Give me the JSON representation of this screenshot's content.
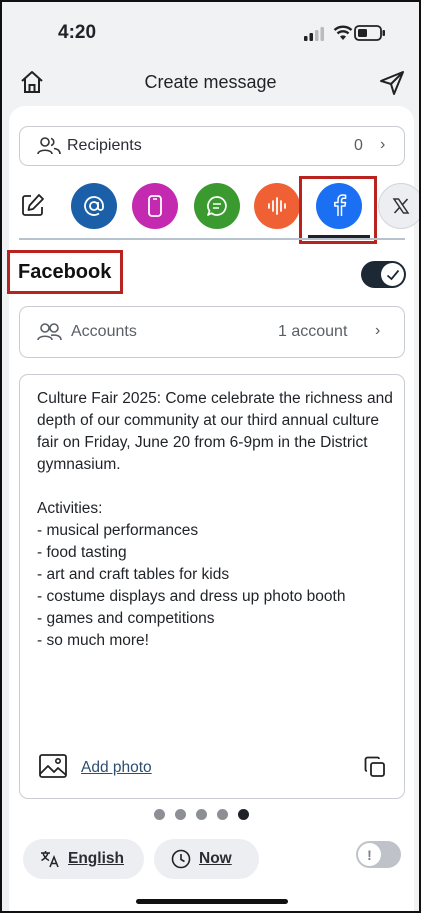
{
  "status_bar": {
    "time": "4:20"
  },
  "header": {
    "title": "Create message",
    "home_icon": "home-icon",
    "send_icon": "paper-plane-icon"
  },
  "recipients": {
    "label": "Recipients",
    "count": "0",
    "icon": "people-icon"
  },
  "channels": [
    {
      "name": "compose",
      "icon": "edit-icon"
    },
    {
      "name": "email",
      "icon": "at-icon",
      "color": "#1b5fa8"
    },
    {
      "name": "app",
      "icon": "phone-icon",
      "color": "#c32ab0"
    },
    {
      "name": "sms",
      "icon": "chat-icon",
      "color": "#3b9a2f"
    },
    {
      "name": "voice",
      "icon": "waveform-icon",
      "color": "#ef6134"
    },
    {
      "name": "facebook",
      "icon": "facebook-icon",
      "color": "#1b6ff2",
      "selected": true
    },
    {
      "name": "x",
      "icon": "x-logo-icon"
    }
  ],
  "section": {
    "title": "Facebook",
    "enabled": true
  },
  "accounts": {
    "label": "Accounts",
    "value": "1 account"
  },
  "message": {
    "text": "Culture Fair 2025: Come celebrate the richness and depth of our community at our third annual culture fair on Friday, June 20 from 6-9pm in the District gymnasium.\n\nActivities:\n- musical performances\n- food tasting\n- art and craft tables for kids\n- costume displays and dress up photo booth\n- games and competitions\n- so much more!",
    "add_photo": "Add photo"
  },
  "pager": {
    "count": 5,
    "active_index": 4
  },
  "footer": {
    "language": "English",
    "schedule": "Now",
    "alert_toggle_on": false
  },
  "colors": {
    "highlight": "#b8231f",
    "accent_dark": "#1c2833"
  }
}
